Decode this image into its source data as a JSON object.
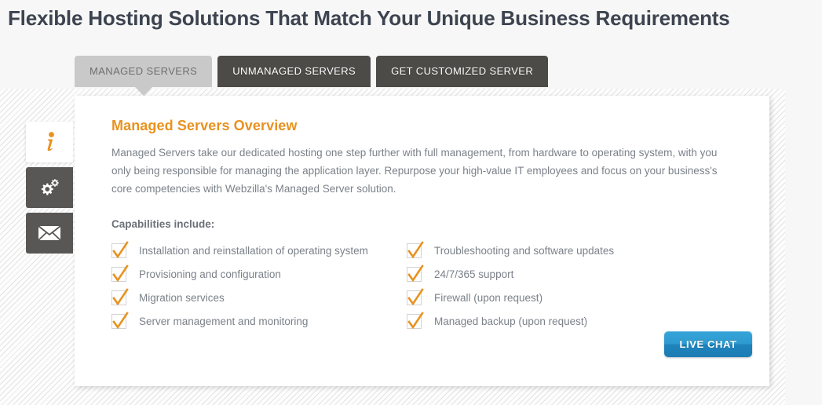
{
  "page": {
    "title": "Flexible Hosting Solutions That Match Your Unique Business Requirements"
  },
  "tabs": [
    {
      "label": "MANAGED SERVERS",
      "active": true
    },
    {
      "label": "UNMANAGED SERVERS",
      "active": false
    },
    {
      "label": "GET CUSTOMIZED SERVER",
      "active": false
    }
  ],
  "side_tabs": [
    {
      "icon": "info-icon",
      "active": true
    },
    {
      "icon": "gears-icon",
      "active": false
    },
    {
      "icon": "envelope-icon",
      "active": false
    }
  ],
  "panel": {
    "heading": "Managed Servers Overview",
    "body": "Managed Servers take our dedicated hosting one step further with full management, from hardware to operating system, with you only being responsible for managing the application layer. Repurpose your high-value IT employees and focus on your business's core competencies with Webzilla's Managed Server solution.",
    "capabilities_label": "Capabilities include:",
    "capabilities_left": [
      "Installation and reinstallation of operating system",
      "Provisioning and configuration",
      "Migration services",
      "Server management and monitoring"
    ],
    "capabilities_right": [
      "Troubleshooting and software updates",
      "24/7/365 support",
      "Firewall (upon request)",
      "Managed backup (upon request)"
    ]
  },
  "actions": {
    "live_chat_label": "LIVE CHAT"
  },
  "colors": {
    "accent_orange": "#e8921f",
    "tab_dark": "#4d4b48",
    "tab_active": "#c9c9c9",
    "button_blue": "#2e9bd0",
    "body_text": "#7b8189",
    "title_text": "#3d4450"
  }
}
